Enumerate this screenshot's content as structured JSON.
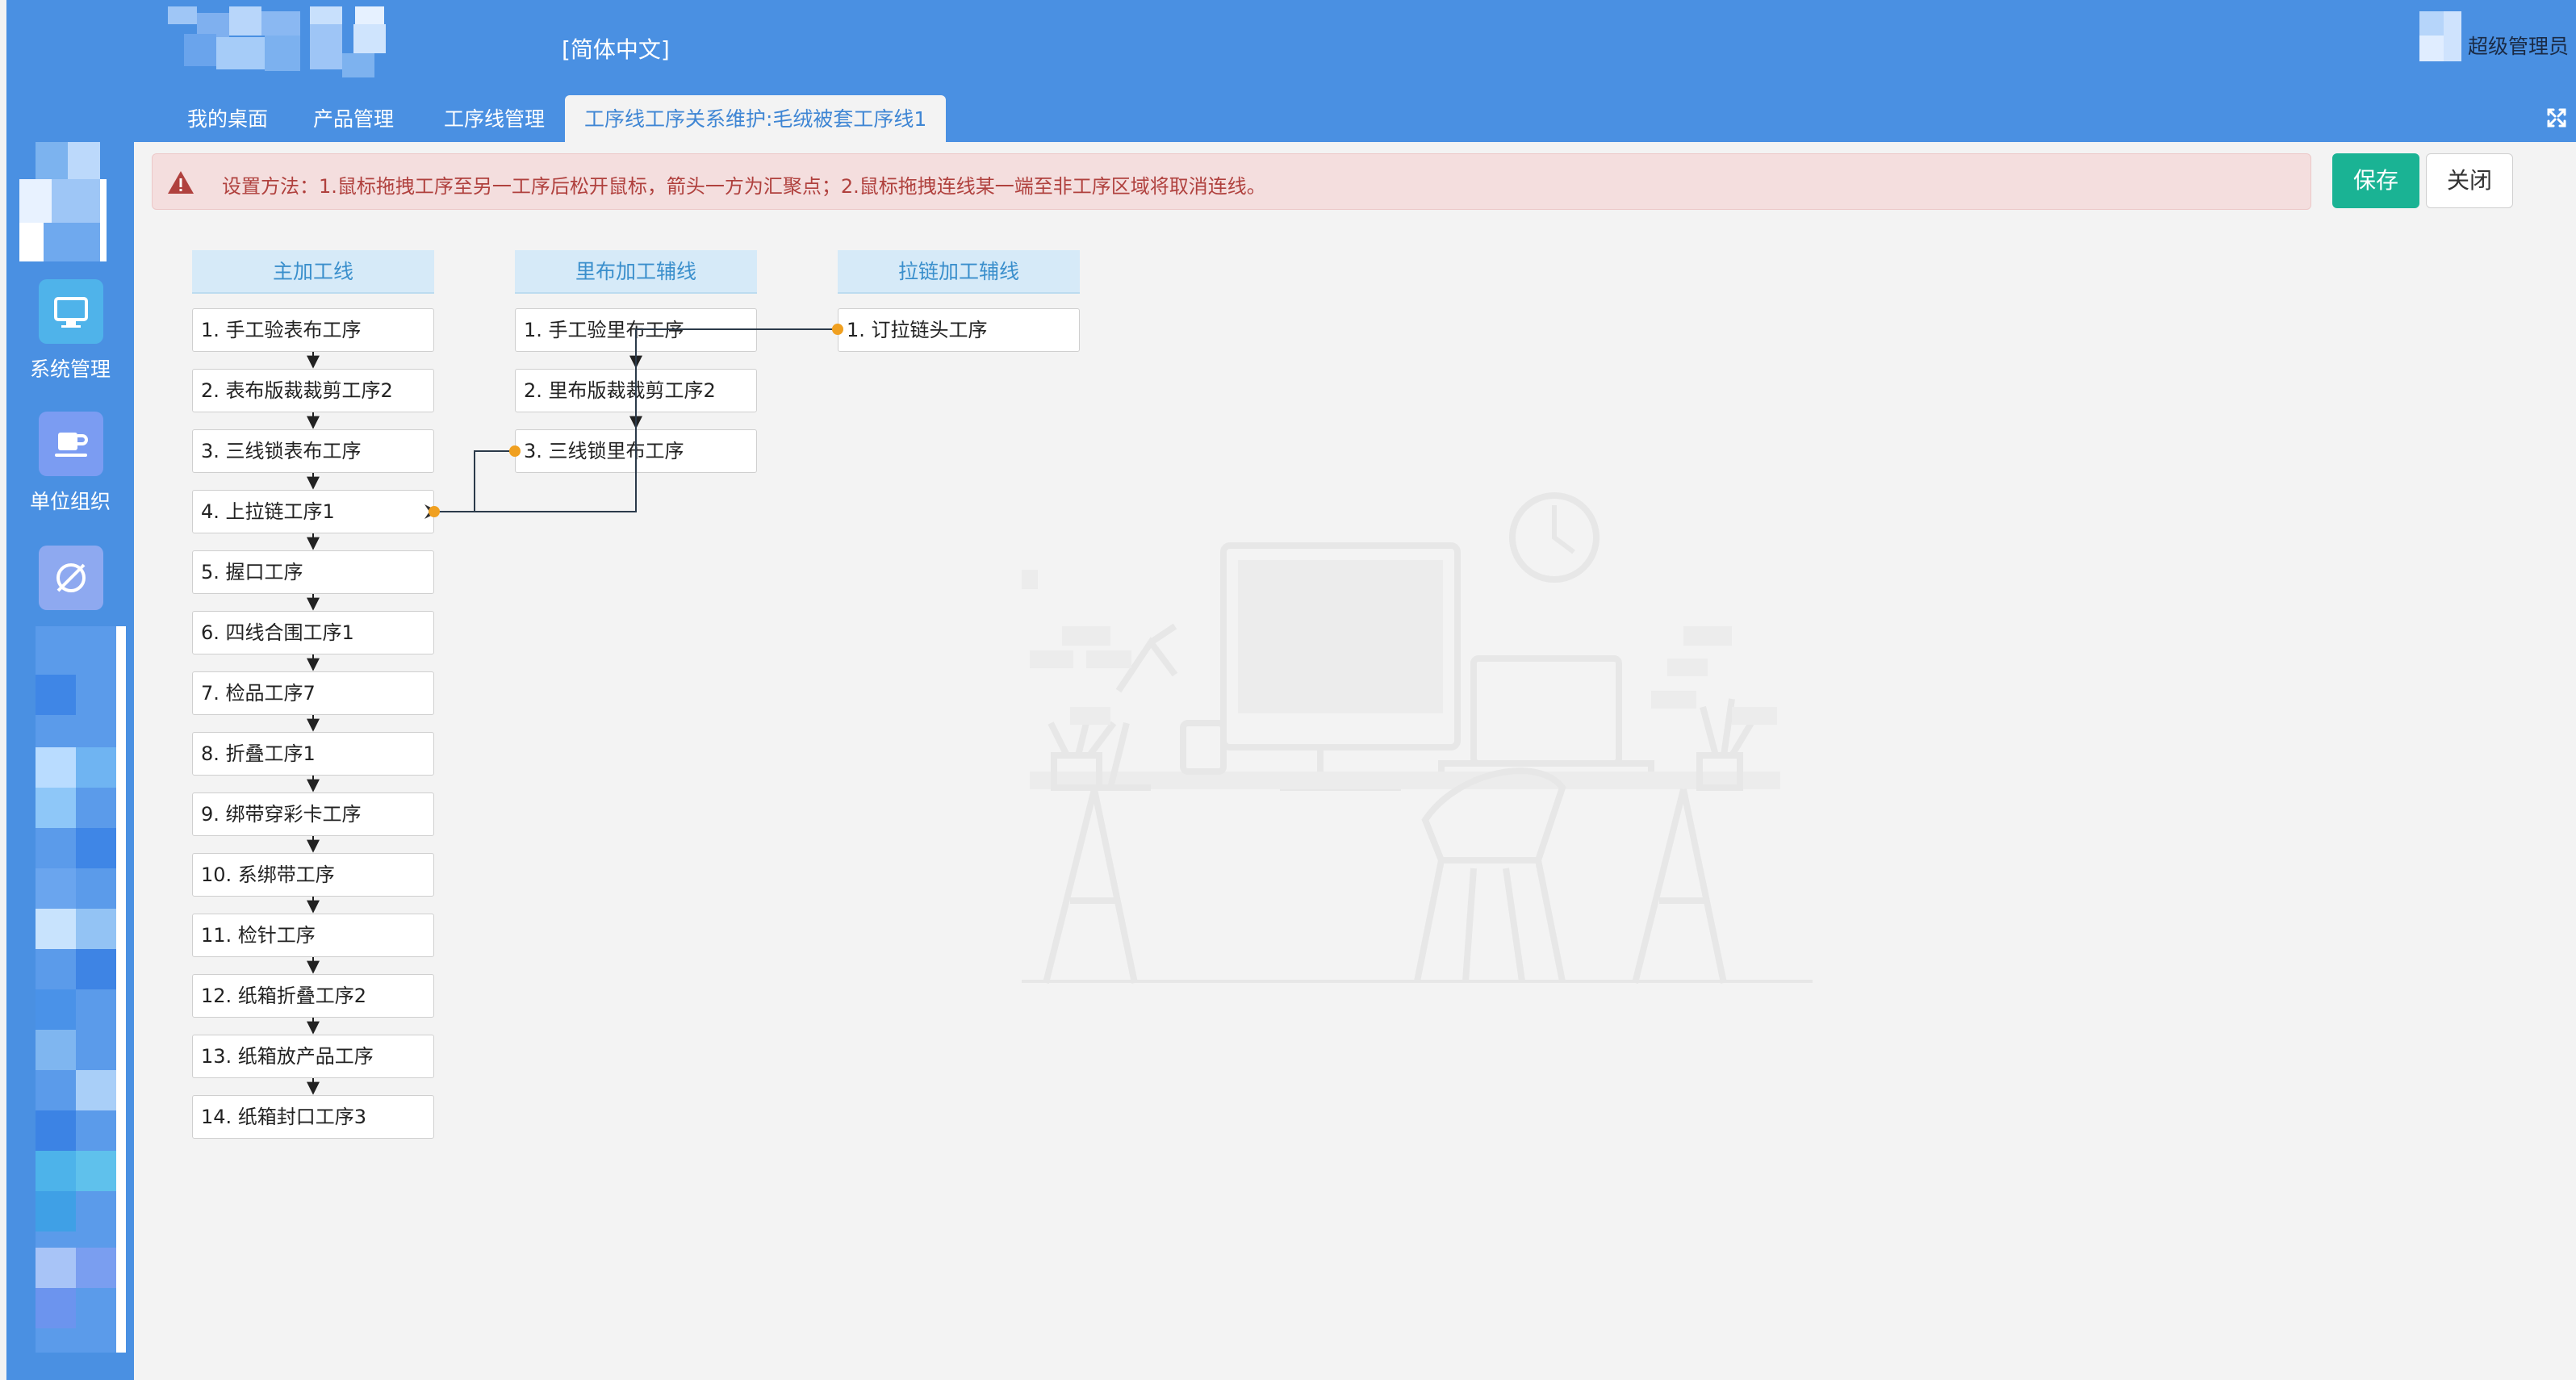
{
  "header": {
    "language": "[简体中文]",
    "user_label": "超级管理员"
  },
  "tabs": [
    {
      "label": "我的桌面"
    },
    {
      "label": "产品管理"
    },
    {
      "label": "工序线管理"
    },
    {
      "label": "工序线工序关系维护:毛绒被套工序线1"
    }
  ],
  "sidebar": {
    "items": [
      {
        "label": "系统管理",
        "icon": "monitor-icon"
      },
      {
        "label": "单位组织",
        "icon": "coffee-cup-icon"
      },
      {
        "label": "",
        "icon": "refresh-circle-icon"
      }
    ]
  },
  "alert": {
    "text": "设置方法：1.鼠标拖拽工序至另一工序后松开鼠标，箭头一方为汇聚点；2.鼠标拖拽连线某一端至非工序区域将取消连线。"
  },
  "actions": {
    "save": "保存",
    "close": "关闭"
  },
  "columns": [
    {
      "title": "主加工线",
      "nodes": [
        "1. 手工验表布工序",
        "2. 表布版裁裁剪工序2",
        "3. 三线锁表布工序",
        "4. 上拉链工序1",
        "5. 握口工序",
        "6. 四线合围工序1",
        "7. 检品工序7",
        "8. 折叠工序1",
        "9. 绑带穿彩卡工序",
        "10. 系绑带工序",
        "11. 检针工序",
        "12. 纸箱折叠工序2",
        "13. 纸箱放产品工序",
        "14. 纸箱封口工序3"
      ]
    },
    {
      "title": "里布加工辅线",
      "nodes": [
        "1. 手工验里布工序",
        "2. 里布版裁裁剪工序2",
        "3. 三线锁里布工序"
      ]
    },
    {
      "title": "拉链加工辅线",
      "nodes": [
        "1. 订拉链头工序"
      ]
    }
  ],
  "connections": [
    {
      "from": "拉链加工辅线 / 1. 订拉链头工序",
      "to": "里布加工辅线 / 1. 手工验里布工序"
    },
    {
      "from": "里布加工辅线 / 3. 三线锁里布工序",
      "to": "主加工线 / 4. 上拉链工序1"
    },
    {
      "from": "里布加工辅线 / 1. 手工验里布工序",
      "to": "主加工线 / 4. 上拉链工序1"
    }
  ],
  "colors": {
    "header_bg": "#4a90e2",
    "save_bg": "#1ab394",
    "alert_bg": "#f4dede",
    "alert_text": "#b0413e",
    "endpoint": "#f0a020"
  }
}
